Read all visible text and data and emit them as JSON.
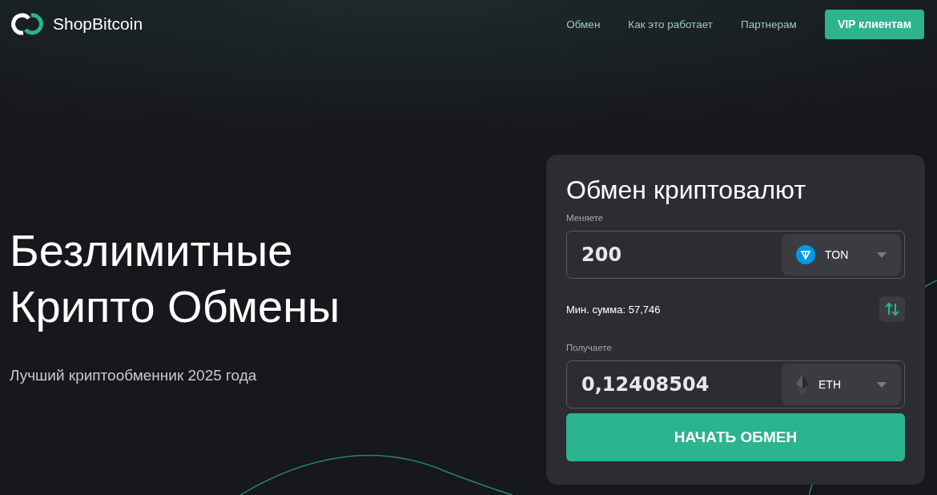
{
  "header": {
    "logo": "ShopBitcoin",
    "nav": [
      "Обмен",
      "Как это работает",
      "Партнерам"
    ],
    "cta": "VIP клиентам"
  },
  "hero": {
    "title_lines": [
      "Безлимитные",
      "Крипто Обмены"
    ],
    "subtitle": "Лучший криптообменник 2025 года"
  },
  "exchange": {
    "title": "Обмен криптовалют",
    "fields": [
      {
        "label": "Меняете",
        "value": "200",
        "currency": "TON",
        "kind": "ton"
      },
      {
        "label": "Получаете",
        "value": "0,12408504",
        "currency": "ETH",
        "kind": "eth"
      }
    ],
    "min_amount": "Мин. сумма: 57,746",
    "submit": "НАЧАТЬ ОБМЕН"
  }
}
